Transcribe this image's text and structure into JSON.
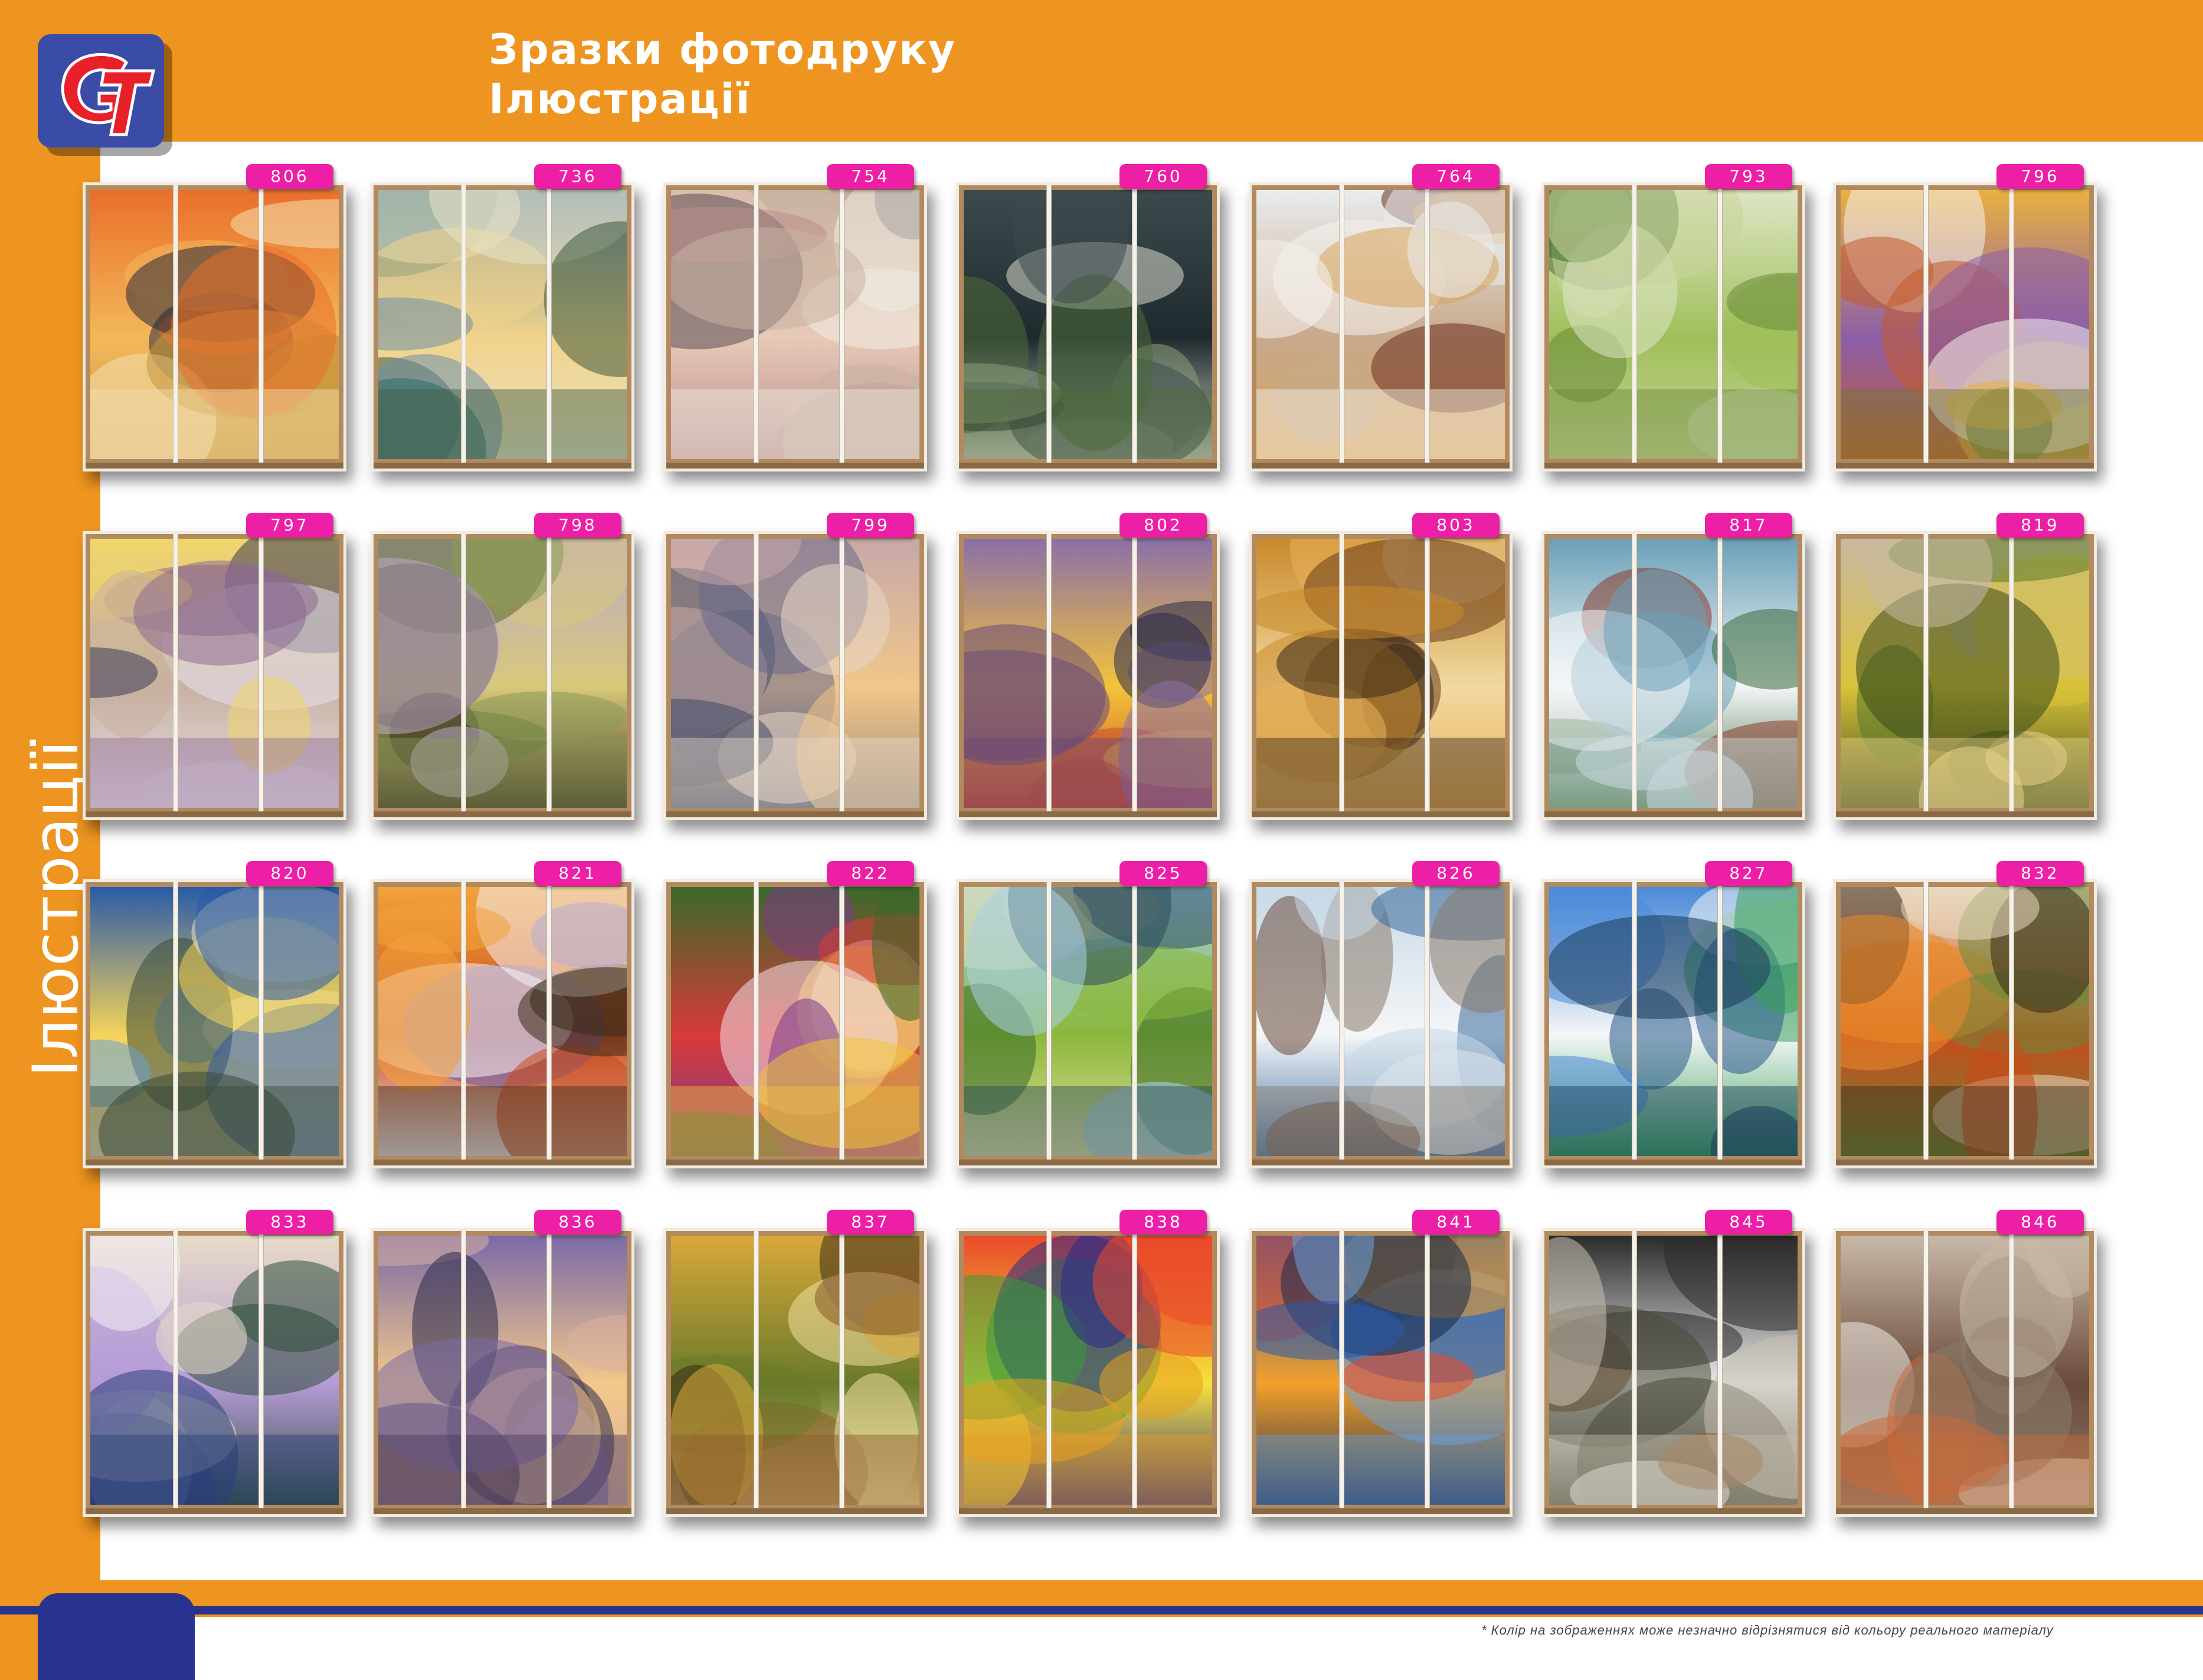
{
  "header": {
    "title_line1": "Зразки фотодруку",
    "title_line2": "Ілюстрації"
  },
  "side_title": "Ілюстрації",
  "logo": {
    "icon": "gt-logo-icon",
    "letters": "GT"
  },
  "footnote": "* Колір на зображеннях може незначно відрізнятися від кольору реального матеріалу",
  "colors": {
    "orange": "#ee9420",
    "blue": "#27338f",
    "badge": "#ec1fa6"
  },
  "items": [
    {
      "code": "806",
      "palette": [
        "#e96f2a",
        "#f3b85a",
        "#2a2a3a",
        "#c7963d",
        "#f5e0b0"
      ]
    },
    {
      "code": "736",
      "palette": [
        "#6e8fa8",
        "#f1d38a",
        "#2f6b6a",
        "#e9e3c9",
        "#3f5a3e"
      ]
    },
    {
      "code": "754",
      "palette": [
        "#c9b2a0",
        "#e7c9b7",
        "#5a4c55",
        "#b98e8a",
        "#f1ede4"
      ]
    },
    {
      "code": "760",
      "palette": [
        "#3c4a4e",
        "#1f2a2e",
        "#8a9f7a",
        "#d8d8cc",
        "#4d6b3a"
      ]
    },
    {
      "code": "764",
      "palette": [
        "#e9ecef",
        "#c7a98c",
        "#6b2e1f",
        "#d9a45a",
        "#f5f3ee"
      ]
    },
    {
      "code": "793",
      "palette": [
        "#dfe6c6",
        "#9fbf5a",
        "#3f6b2e",
        "#c8d39a",
        "#6a8a3a"
      ]
    },
    {
      "code": "796",
      "palette": [
        "#e9b040",
        "#8c5fa8",
        "#f4f1ee",
        "#c45a2a",
        "#6a7a3a"
      ]
    },
    {
      "code": "797",
      "palette": [
        "#f1d66b",
        "#c8b1a0",
        "#3a3a55",
        "#e8e2f1",
        "#8d6a8f"
      ]
    },
    {
      "code": "798",
      "palette": [
        "#b9a9c9",
        "#d9c97a",
        "#5a6a2a",
        "#3a2e1f",
        "#8a9a5a"
      ]
    },
    {
      "code": "799",
      "palette": [
        "#c7a8a8",
        "#f1c68a",
        "#6a6a8a",
        "#3f4a66",
        "#e7d7c7"
      ]
    },
    {
      "code": "802",
      "palette": [
        "#8a6fa8",
        "#f3c33a",
        "#2a2a4a",
        "#c84a2a",
        "#6a4a7a"
      ]
    },
    {
      "code": "803",
      "palette": [
        "#c88a2a",
        "#f1d9a0",
        "#6a3a1a",
        "#e9b05a",
        "#3a2a1a"
      ]
    },
    {
      "code": "817",
      "palette": [
        "#6aa0b8",
        "#f4f6f8",
        "#8a3a2a",
        "#3a6a3a",
        "#c9d9e0"
      ]
    },
    {
      "code": "819",
      "palette": [
        "#c9b9a0",
        "#d9c23a",
        "#5a7a2a",
        "#3a4a1a",
        "#e8d28a"
      ]
    },
    {
      "code": "820",
      "palette": [
        "#2a5aa8",
        "#f3d35a",
        "#6aa0d0",
        "#e9e2c0",
        "#3a4a3a"
      ]
    },
    {
      "code": "821",
      "palette": [
        "#f2a33a",
        "#c84a1a",
        "#6a5aa8",
        "#f4f2f8",
        "#3a2a1a"
      ]
    },
    {
      "code": "822",
      "palette": [
        "#3a6a2a",
        "#d83a3a",
        "#f4e0e8",
        "#7a3a8a",
        "#f1c33a"
      ]
    },
    {
      "code": "825",
      "palette": [
        "#a8d0e8",
        "#8ab83a",
        "#3a6a2a",
        "#e9e0a0",
        "#2a4a5a"
      ]
    },
    {
      "code": "826",
      "palette": [
        "#c9d9e8",
        "#f4f6f8",
        "#6a4a3a",
        "#3a6a9a",
        "#8a7a6a"
      ]
    },
    {
      "code": "827",
      "palette": [
        "#4a8ad8",
        "#f4f6f8",
        "#2a5a8a",
        "#3aa05a",
        "#1a3a5a"
      ]
    },
    {
      "code": "832",
      "palette": [
        "#e9d9c0",
        "#c84a1a",
        "#e98a2a",
        "#6a8a3a",
        "#3a2a1a"
      ]
    },
    {
      "code": "833",
      "palette": [
        "#e8dcc8",
        "#b59ad8",
        "#f2eef6",
        "#2f4f3a",
        "#2a3f7a"
      ]
    },
    {
      "code": "836",
      "palette": [
        "#7a6aa8",
        "#f3c88a",
        "#2a2a4a",
        "#d8b0a0",
        "#4a3a5a"
      ]
    },
    {
      "code": "837",
      "palette": [
        "#d9a83a",
        "#6a7a2a",
        "#3a2a1a",
        "#f1e0a0",
        "#8a5a2a"
      ]
    },
    {
      "code": "838",
      "palette": [
        "#e94a2a",
        "#f7e23a",
        "#3a9a3a",
        "#2a2a8a",
        "#e8a020"
      ]
    },
    {
      "code": "841",
      "palette": [
        "#2a5aa8",
        "#f3a02a",
        "#e94a2a",
        "#1a2a4a",
        "#6aa0d8"
      ]
    },
    {
      "code": "845",
      "palette": [
        "#2a2a2a",
        "#e9e9e9",
        "#8a5a2a",
        "#4a4a3a",
        "#c9c0b0"
      ]
    },
    {
      "code": "846",
      "palette": [
        "#c9b9a8",
        "#6a4a3a",
        "#f1ede6",
        "#8a7a6a",
        "#c86a3a"
      ]
    }
  ]
}
